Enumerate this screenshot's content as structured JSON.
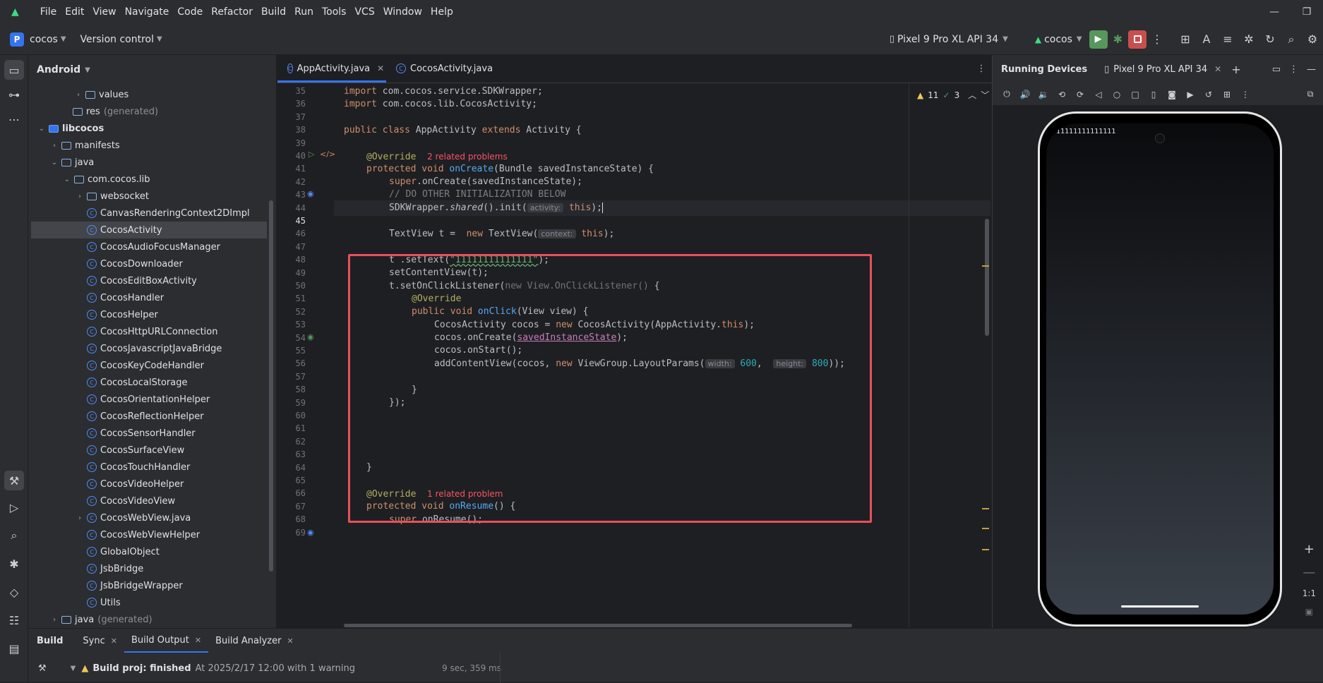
{
  "menu": [
    "File",
    "Edit",
    "View",
    "Navigate",
    "Code",
    "Refactor",
    "Build",
    "Run",
    "Tools",
    "VCS",
    "Window",
    "Help"
  ],
  "toolbar": {
    "project_initial": "P",
    "project_name": "cocos",
    "version_control": "Version control",
    "device": "Pixel 9 Pro XL API 34",
    "run_config": "cocos"
  },
  "project_panel": {
    "title": "Android",
    "rows": [
      {
        "label": "values",
        "gen": ""
      },
      {
        "label": "res",
        "gen": "(generated)"
      },
      {
        "label": "libcocos",
        "gen": ""
      },
      {
        "label": "manifests",
        "gen": ""
      },
      {
        "label": "java",
        "gen": ""
      },
      {
        "label": "com.cocos.lib",
        "gen": ""
      },
      {
        "label": "websocket",
        "gen": ""
      },
      {
        "label": "CanvasRenderingContext2DImpl",
        "gen": ""
      },
      {
        "label": "CocosActivity",
        "gen": ""
      },
      {
        "label": "CocosAudioFocusManager",
        "gen": ""
      },
      {
        "label": "CocosDownloader",
        "gen": ""
      },
      {
        "label": "CocosEditBoxActivity",
        "gen": ""
      },
      {
        "label": "CocosHandler",
        "gen": ""
      },
      {
        "label": "CocosHelper",
        "gen": ""
      },
      {
        "label": "CocosHttpURLConnection",
        "gen": ""
      },
      {
        "label": "CocosJavascriptJavaBridge",
        "gen": ""
      },
      {
        "label": "CocosKeyCodeHandler",
        "gen": ""
      },
      {
        "label": "CocosLocalStorage",
        "gen": ""
      },
      {
        "label": "CocosOrientationHelper",
        "gen": ""
      },
      {
        "label": "CocosReflectionHelper",
        "gen": ""
      },
      {
        "label": "CocosSensorHandler",
        "gen": ""
      },
      {
        "label": "CocosSurfaceView",
        "gen": ""
      },
      {
        "label": "CocosTouchHandler",
        "gen": ""
      },
      {
        "label": "CocosVideoHelper",
        "gen": ""
      },
      {
        "label": "CocosVideoView",
        "gen": ""
      },
      {
        "label": "CocosWebView.java",
        "gen": ""
      },
      {
        "label": "CocosWebViewHelper",
        "gen": ""
      },
      {
        "label": "GlobalObject",
        "gen": ""
      },
      {
        "label": "JsbBridge",
        "gen": ""
      },
      {
        "label": "JsbBridgeWrapper",
        "gen": ""
      },
      {
        "label": "Utils",
        "gen": ""
      },
      {
        "label": "java",
        "gen": "(generated)"
      }
    ]
  },
  "editor": {
    "tabs": [
      "AppActivity.java",
      "CocosActivity.java"
    ],
    "warnings": "11",
    "weak_warnings": "3",
    "line_numbers": [
      "35",
      "36",
      "37",
      "38",
      "39",
      "40",
      "41",
      "42",
      "43",
      "44",
      "45",
      "46",
      "47",
      "48",
      "49",
      "50",
      "51",
      "52",
      "53",
      "54",
      "55",
      "56",
      "57",
      "58",
      "59",
      "60",
      "61",
      "62",
      "63",
      "64",
      "65",
      "66",
      "67",
      "68",
      "69"
    ],
    "current_line": "45",
    "code": {
      "l36a": "import ",
      "l36b": "com.cocos.service.SDKWrapper;",
      "l37a": "import ",
      "l37b": "com.cocos.lib.CocosActivity;",
      "l39a": "public class ",
      "l39b": "AppActivity ",
      "l39c": "extends ",
      "l39d": "Activity {",
      "l41a": "@Override",
      "l41b": "2 related problems",
      "l42a": "protected void ",
      "l42b": "onCreate",
      "l42c": "(Bundle savedInstanceState) {",
      "l43a": "super",
      "l43b": ".onCreate(savedInstanceState);",
      "l44": "// DO OTHER INITIALIZATION BELOW",
      "l45a": "SDKWrapper.",
      "l45b": "shared",
      "l45c": "().init(",
      "l45d": "activity:",
      "l45e": "this",
      "l45f": ");",
      "l47a": "TextView t =  ",
      "l47b": "new ",
      "l47c": "TextView(",
      "l47d": "context:",
      "l47e": "this",
      "l47f": ");",
      "l49a": "t .setText(",
      "l49b": "\"11111111111111\"",
      "l49c": ");",
      "l50": "setContentView(t);",
      "l51a": "t.setOnClickListener(",
      "l51b": "new View.OnClickListener() ",
      "l51c": "{",
      "l52": "@Override",
      "l53a": "public void ",
      "l53b": "onClick",
      "l53c": "(View view) {",
      "l54a": "CocosActivity cocos = ",
      "l54b": "new ",
      "l54c": "CocosActivity(AppActivity.",
      "l54d": "this",
      "l54e": ");",
      "l55a": "cocos.onCreate(",
      "l55b": "savedInstanceState",
      "l55c": ");",
      "l56": "cocos.onStart();",
      "l57a": "addContentView(cocos, ",
      "l57b": "new ",
      "l57c": "ViewGroup.LayoutParams(",
      "l57d": "width:",
      "l57e": "600",
      "l57f": ",  ",
      "l57g": "height:",
      "l57h": "800",
      "l57i": "));",
      "l59": "}",
      "l60": "});",
      "l65": "}",
      "l67a": "@Override",
      "l67b": "1 related problem",
      "l68a": "protected void ",
      "l68b": "onResume",
      "l68c": "() {",
      "l69a": "super",
      "l69b": ".onResume();"
    }
  },
  "devices": {
    "title": "Running Devices",
    "device_tab": "Pixel 9 Pro XL API 34",
    "phone_text": "11111111111111",
    "zoom_label": "1:1"
  },
  "bottom": {
    "tabs": [
      "Build",
      "Sync",
      "Build Output",
      "Build Analyzer"
    ],
    "status_bold": "Build proj: finished",
    "status_detail": "At 2025/2/17 12:00 with 1 warning",
    "duration": "9 sec, 359 ms"
  }
}
